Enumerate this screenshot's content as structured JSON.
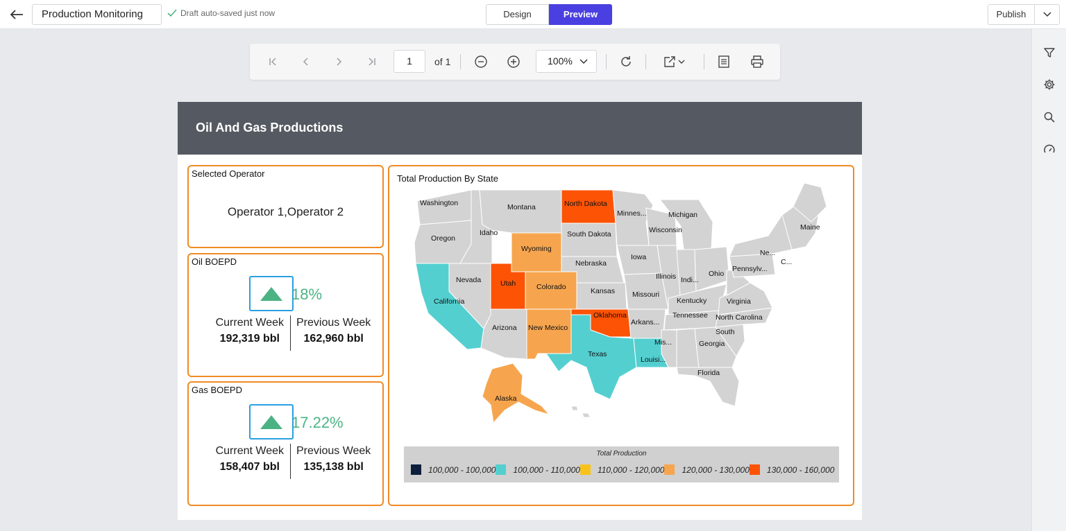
{
  "topbar": {
    "title": "Production Monitoring",
    "autosave": "Draft auto-saved just now",
    "design_label": "Design",
    "preview_label": "Preview",
    "publish_label": "Publish"
  },
  "viewer": {
    "page": "1",
    "of_label": "of 1",
    "zoom": "100%"
  },
  "report": {
    "title": "Oil And Gas Productions",
    "operator": {
      "label": "Selected Operator",
      "value": "Operator 1,Operator 2"
    },
    "oil": {
      "label": "Oil BOEPD",
      "pct": "18%",
      "current_label": "Current Week",
      "previous_label": "Previous Week",
      "current": "192,319 bbl",
      "previous": "162,960 bbl"
    },
    "gas": {
      "label": "Gas BOEPD",
      "pct": "17.22%",
      "current_label": "Current Week",
      "previous_label": "Previous Week",
      "current": "158,407 bbl",
      "previous": "135,138 bbl"
    },
    "map": {
      "title": "Total Production By State",
      "legend_title": "Total Production",
      "legend": [
        {
          "label": "100,000 - 100,000",
          "color": "#0d1f3c"
        },
        {
          "label": "100,000 - 110,000",
          "color": "#54cfd0"
        },
        {
          "label": "110,000 - 120,000",
          "color": "#f8c21c"
        },
        {
          "label": "120,000 - 130,000",
          "color": "#f6a54e"
        },
        {
          "label": "130,000 - 160,000",
          "color": "#fc5305"
        }
      ],
      "states": [
        {
          "name": "Washington"
        },
        {
          "name": "Montana"
        },
        {
          "name": "North Dakota"
        },
        {
          "name": "Minnes..."
        },
        {
          "name": "Michigan"
        },
        {
          "name": "Maine"
        },
        {
          "name": "Oregon"
        },
        {
          "name": "Idaho"
        },
        {
          "name": "Wyoming"
        },
        {
          "name": "South Dakota"
        },
        {
          "name": "Wisconsin"
        },
        {
          "name": "Ne..."
        },
        {
          "name": "C..."
        },
        {
          "name": "Nebraska"
        },
        {
          "name": "Iowa"
        },
        {
          "name": "Pennsylv..."
        },
        {
          "name": "Nevada"
        },
        {
          "name": "Utah"
        },
        {
          "name": "Colorado"
        },
        {
          "name": "Kansas"
        },
        {
          "name": "Illinois"
        },
        {
          "name": "Indi..."
        },
        {
          "name": "Ohio"
        },
        {
          "name": "California"
        },
        {
          "name": "Missouri"
        },
        {
          "name": "Kentucky"
        },
        {
          "name": "Virginia"
        },
        {
          "name": "Oklahoma"
        },
        {
          "name": "Tennessee"
        },
        {
          "name": "North Carolina"
        },
        {
          "name": "Arizona"
        },
        {
          "name": "New Mexico"
        },
        {
          "name": "Arkans..."
        },
        {
          "name": "South"
        },
        {
          "name": "Mis..."
        },
        {
          "name": "Georgia"
        },
        {
          "name": "Texas"
        },
        {
          "name": "Louisi..."
        },
        {
          "name": "Florida"
        },
        {
          "name": "Alaska"
        }
      ]
    }
  }
}
